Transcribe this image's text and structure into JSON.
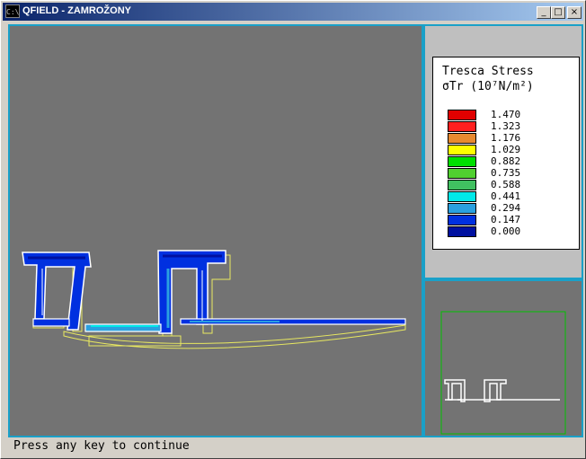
{
  "window": {
    "title": "QFIELD - ZAMROŽONY",
    "icon_label": "C:\\",
    "minimize_label": "_",
    "maximize_label": "□",
    "close_label": "×"
  },
  "legend": {
    "title": "Tresca Stress",
    "subtitle": "σTr (10⁷N/m²)",
    "entries": [
      {
        "value": "1.470",
        "color": "#e00000"
      },
      {
        "value": "1.323",
        "color": "#ff2020"
      },
      {
        "value": "1.176",
        "color": "#e88a30"
      },
      {
        "value": "1.029",
        "color": "#ffff00"
      },
      {
        "value": "0.882",
        "color": "#00e000"
      },
      {
        "value": "0.735",
        "color": "#50d030"
      },
      {
        "value": "0.588",
        "color": "#40c060"
      },
      {
        "value": "0.441",
        "color": "#00e8e8"
      },
      {
        "value": "0.294",
        "color": "#2aa0e0"
      },
      {
        "value": "0.147",
        "color": "#0030e0"
      },
      {
        "value": "0.000",
        "color": "#0010a0"
      }
    ]
  },
  "status": {
    "text": "Press any key to continue"
  },
  "colors": {
    "accent_border": "#1aa0c8",
    "viewport_bg": "#737373",
    "undeformed_outline": "#e8e860",
    "minimap_frame": "#00c000"
  }
}
